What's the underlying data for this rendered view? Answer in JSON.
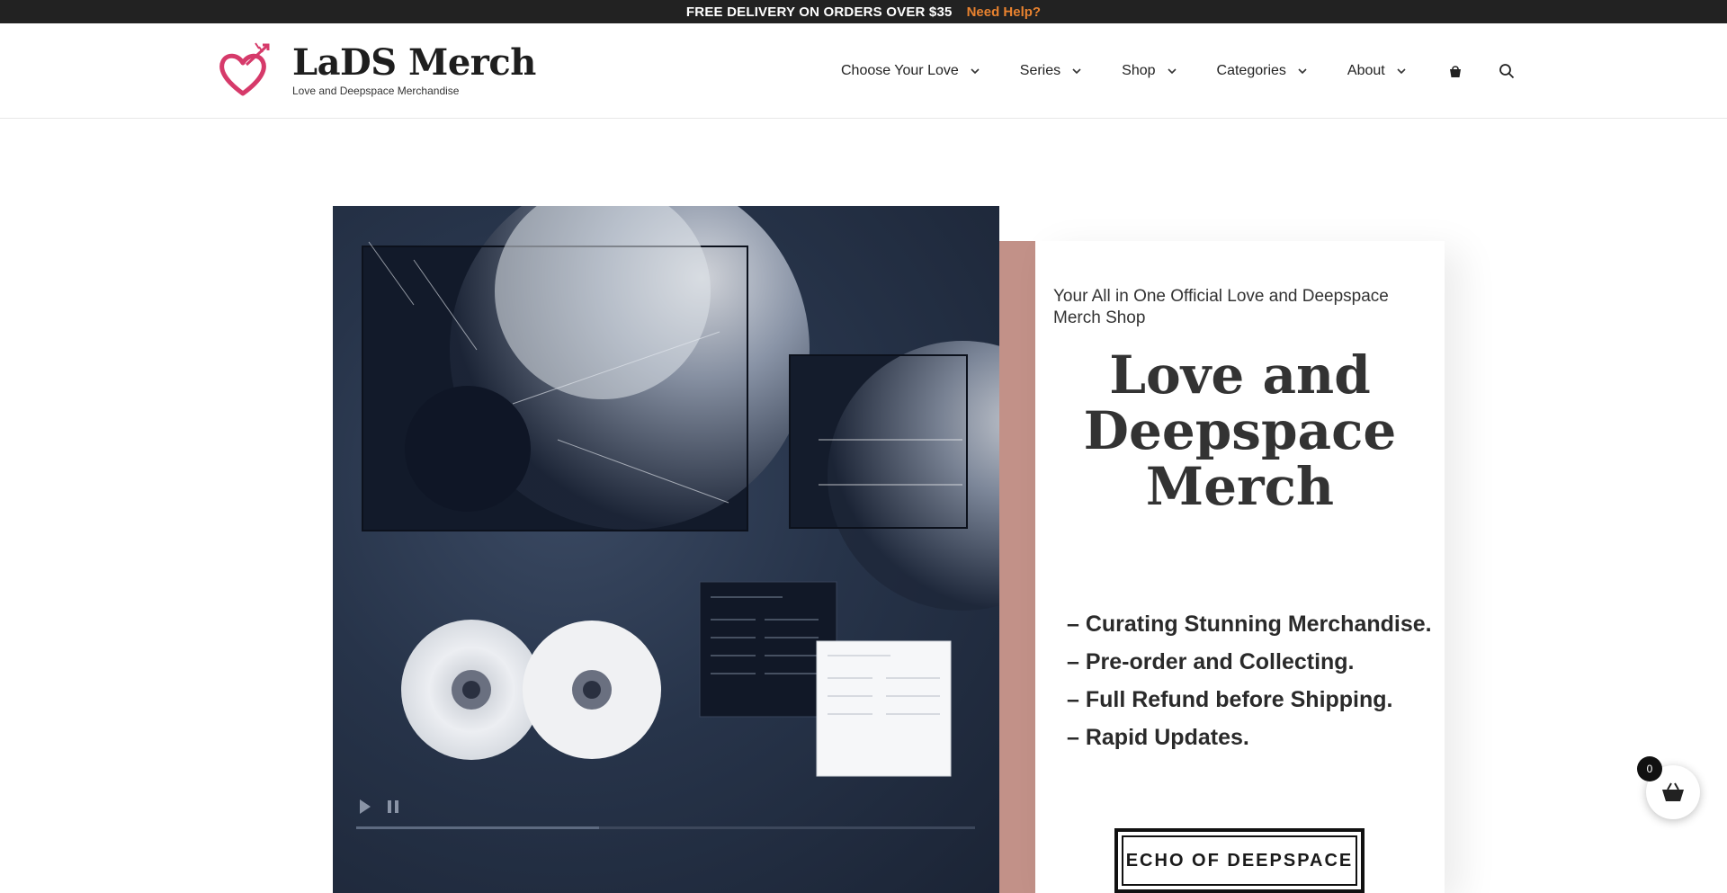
{
  "topbar": {
    "promo": "FREE DELIVERY ON ORDERS OVER $35",
    "help_link": "Need Help?",
    "help_color": "#e8822f"
  },
  "header": {
    "brand_title": "LaDS Merch",
    "brand_tagline": "Love and Deepspace Merchandise",
    "logo_icon": "heart-arrow-logo",
    "logo_color": "#d63a6a",
    "nav": [
      {
        "label": "Choose Your Love"
      },
      {
        "label": "Series"
      },
      {
        "label": "Shop"
      },
      {
        "label": "Categories"
      },
      {
        "label": "About"
      }
    ],
    "icons": [
      "shopping-bag-icon",
      "search-icon"
    ]
  },
  "hero": {
    "image_icon": "album-product-photo",
    "card": {
      "subtitle": "Your All in One Official Love and Deepspace Merch Shop",
      "headline": "Love and Deepspace Merch",
      "bullets": [
        "– Curating Stunning Merchandise.",
        "– Pre-order and Collecting.",
        "– Full Refund before Shipping.",
        "– Rapid Updates."
      ],
      "cta": "ECHO OF DEEPSPACE"
    },
    "accent_color": "#c29188"
  },
  "cart": {
    "count": "0"
  }
}
